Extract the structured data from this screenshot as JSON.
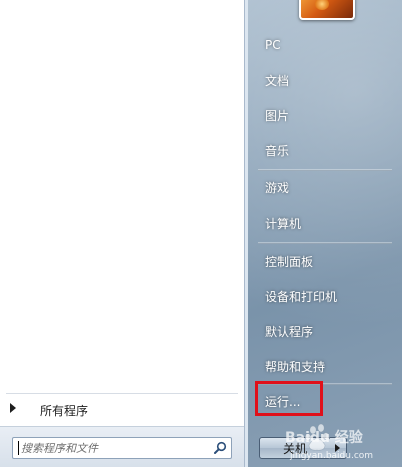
{
  "left_pane": {
    "all_programs_label": "所有程序",
    "search": {
      "placeholder": "搜索程序和文件",
      "value": ""
    }
  },
  "right_pane": {
    "items": [
      {
        "label": "PC"
      },
      {
        "label": "文档"
      },
      {
        "label": "图片"
      },
      {
        "label": "音乐"
      },
      {
        "label": "游戏"
      },
      {
        "label": "计算机"
      },
      {
        "label": "控制面板"
      },
      {
        "label": "设备和打印机"
      },
      {
        "label": "默认程序"
      },
      {
        "label": "帮助和支持"
      },
      {
        "label": "运行..."
      }
    ],
    "highlighted_item": "运行..."
  },
  "shutdown": {
    "label": "关机"
  },
  "watermark": {
    "brand": "Baidu 经验",
    "url": "jingyan.baidu.com"
  },
  "colors": {
    "highlight_border": "#e0101a",
    "right_pane_bg": "#8ea5ba",
    "left_pane_bg": "#ffffff"
  }
}
